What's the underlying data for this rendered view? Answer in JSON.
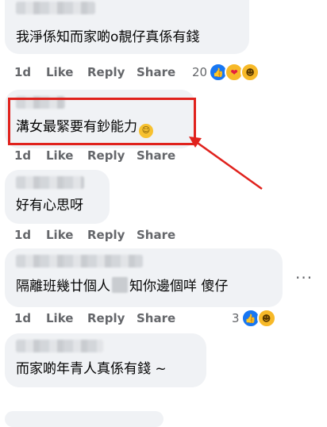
{
  "comments": [
    {
      "text": "我淨係知而家啲o靚仔真係有錢",
      "time": "1d",
      "like": "Like",
      "reply": "Reply",
      "share": "Share",
      "reaction_count": "20"
    },
    {
      "text": "溝女最緊要有鈔能力",
      "time": "1d",
      "like": "Like",
      "reply": "Reply",
      "share": "Share"
    },
    {
      "text": "好有心思呀",
      "time": "1d",
      "like": "Like",
      "reply": "Reply",
      "share": "Share"
    },
    {
      "text_before": "隔離班幾廿個人",
      "text_after": "知你邊個咩 傻仔",
      "time": "1d",
      "like": "Like",
      "reply": "Reply",
      "share": "Share",
      "reaction_count": "3"
    },
    {
      "text": "而家啲年青人真係有錢 ~"
    }
  ],
  "more_options": "···",
  "icons": {
    "like": "like-reaction-icon",
    "haha": "haha-reaction-icon",
    "care": "care-reaction-icon",
    "inline": "hushed-face-emoji"
  },
  "colors": {
    "bubble": "#f0f2f5",
    "highlight": "#e0221d",
    "like_blue": "#1877f2",
    "muted": "#65676b"
  }
}
